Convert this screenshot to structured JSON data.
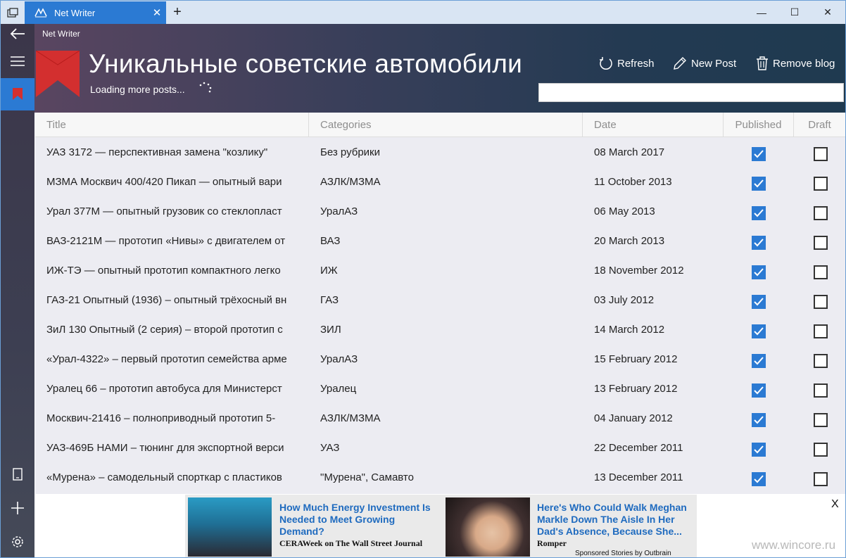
{
  "window": {
    "tab_title": "Net Writer",
    "tab_close": "✕",
    "new_tab": "+",
    "minimize": "—",
    "maximize": "☐",
    "close": "✕"
  },
  "app": {
    "name": "Net Writer",
    "blog_title": "Уникальные советские автомобили",
    "status": "Loading more posts...",
    "commands": {
      "refresh": "Refresh",
      "new_post": "New Post",
      "remove_blog": "Remove blog"
    },
    "search_value": ""
  },
  "grid": {
    "columns": [
      "Title",
      "Categories",
      "Date",
      "Published",
      "Draft"
    ],
    "rows": [
      {
        "title": "УАЗ 3172 — перспективная замена \"козлику\"",
        "category": "Без рубрики",
        "date": "08 March 2017",
        "published": true,
        "draft": false
      },
      {
        "title": "МЗМА Москвич 400/420 Пикап — опытный вари",
        "category": "АЗЛК/МЗМА",
        "date": "11 October 2013",
        "published": true,
        "draft": false
      },
      {
        "title": "Урал 377М — опытный грузовик со стеклопласт",
        "category": "УралАЗ",
        "date": "06 May 2013",
        "published": true,
        "draft": false
      },
      {
        "title": "ВАЗ-2121М — прототип «Нивы» с двигателем от",
        "category": "ВАЗ",
        "date": "20 March 2013",
        "published": true,
        "draft": false
      },
      {
        "title": "ИЖ-ТЭ — опытный прототип компактного легко",
        "category": "ИЖ",
        "date": "18 November 2012",
        "published": true,
        "draft": false
      },
      {
        "title": "ГАЗ-21 Опытный (1936) – опытный трёхосный вн",
        "category": "ГАЗ",
        "date": "03 July 2012",
        "published": true,
        "draft": false
      },
      {
        "title": "ЗиЛ 130 Опытный (2 серия) – второй прототип с",
        "category": "ЗИЛ",
        "date": "14 March 2012",
        "published": true,
        "draft": false
      },
      {
        "title": "«Урал-4322» – первый прототип семейства арме",
        "category": "УралАЗ",
        "date": "15 February 2012",
        "published": true,
        "draft": false
      },
      {
        "title": "Уралец 66 – прототип автобуса для Министерст",
        "category": "Уралец",
        "date": "13 February 2012",
        "published": true,
        "draft": false
      },
      {
        "title": "Москвич-21416 – полноприводный прототип 5-",
        "category": "АЗЛК/МЗМА",
        "date": "04 January 2012",
        "published": true,
        "draft": false
      },
      {
        "title": "УАЗ-469Б НАМИ – тюнинг для экспортной верси",
        "category": "УАЗ",
        "date": "22 December 2011",
        "published": true,
        "draft": false
      },
      {
        "title": "«Мурена» – самодельный спорткар с пластиков",
        "category": "\"Мурена\", Самавто",
        "date": "13 December 2011",
        "published": true,
        "draft": false
      }
    ]
  },
  "ad": {
    "items": [
      {
        "headline": "How Much Energy Investment Is Needed to Meet Growing Demand?",
        "source": "CERAWeek on The Wall Street Journal"
      },
      {
        "headline": "Here's Who Could Walk Meghan Markle Down The Aisle In Her Dad's Absence, Because She...",
        "source": "Romper"
      }
    ],
    "sponsored": "Sponsored Stories by Outbrain",
    "close": "X"
  },
  "watermark": "www.wincore.ru",
  "colors": {
    "accent": "#2b7ad3",
    "flag": "#d32f2f"
  }
}
